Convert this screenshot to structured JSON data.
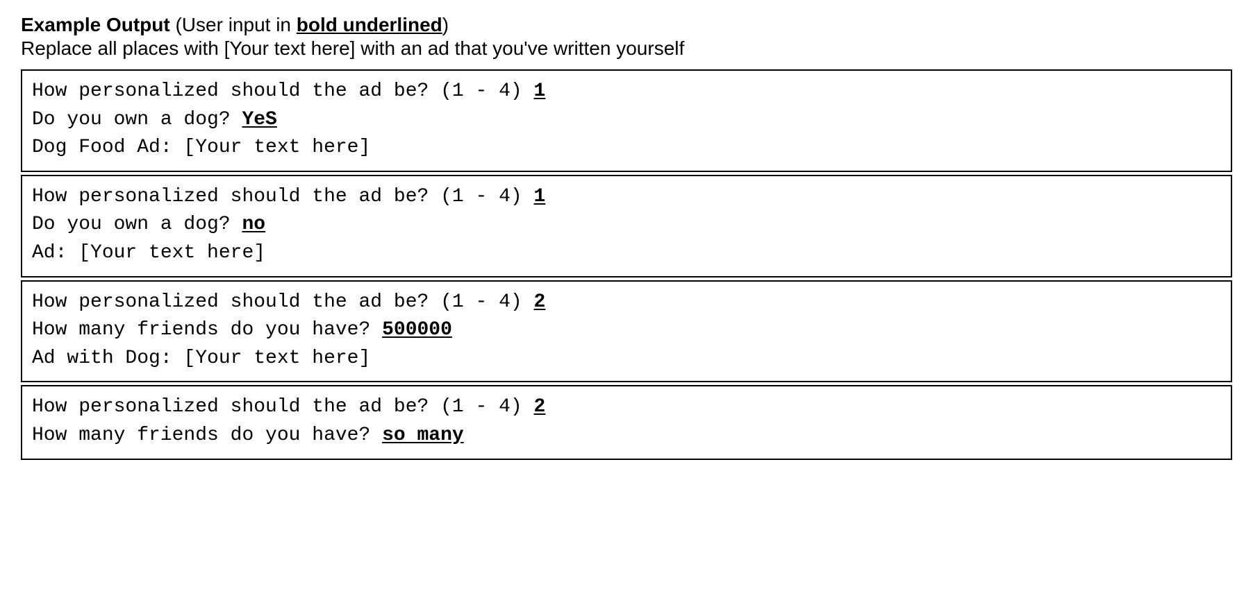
{
  "heading": {
    "bold_prefix": "Example Output",
    "rest_before": " (User input in ",
    "styled_phrase": "bold underlined",
    "rest_after": ")"
  },
  "instruction": "Replace all places with [Your text here] with an ad that you've written yourself",
  "examples": [
    {
      "lines": [
        {
          "prompt": "How personalized should the ad be? (1 - 4) ",
          "input": "1"
        },
        {
          "prompt": "Do you own a dog? ",
          "input": "YeS"
        },
        {
          "prompt": "Dog Food Ad: [Your text here]",
          "input": ""
        }
      ]
    },
    {
      "lines": [
        {
          "prompt": "How personalized should the ad be? (1 - 4) ",
          "input": "1"
        },
        {
          "prompt": "Do you own a dog? ",
          "input": "no"
        },
        {
          "prompt": "Ad: [Your text here]",
          "input": ""
        }
      ]
    },
    {
      "lines": [
        {
          "prompt": "How personalized should the ad be? (1 - 4) ",
          "input": "2"
        },
        {
          "prompt": "How many friends do you have? ",
          "input": "500000"
        },
        {
          "prompt": "Ad with Dog: [Your text here]",
          "input": ""
        }
      ]
    },
    {
      "lines": [
        {
          "prompt": "How personalized should the ad be? (1 - 4) ",
          "input": "2"
        },
        {
          "prompt": "How many friends do you have? ",
          "input": "so many"
        }
      ]
    }
  ]
}
